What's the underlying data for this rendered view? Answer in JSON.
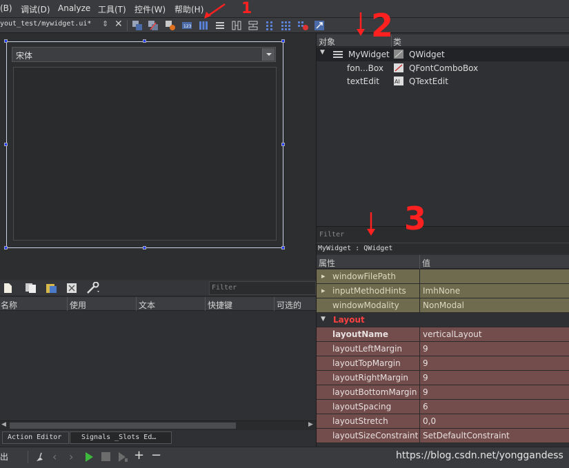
{
  "menu": [
    "(B)",
    "调试(D)",
    "Analyze",
    "工具(T)",
    "控件(W)",
    "帮助(H)"
  ],
  "file": {
    "name": "yout_test/mywidget.ui*"
  },
  "canvas": {
    "combo_text": "宋体"
  },
  "objects": {
    "header": [
      "对象",
      "类"
    ],
    "rows": [
      {
        "name": "MyWidget",
        "cls": "QWidget"
      },
      {
        "name": "fon...Box",
        "cls": "QFontComboBox"
      },
      {
        "name": "textEdit",
        "cls": "QTextEdit"
      }
    ]
  },
  "filter": {
    "placeholder": "Filter",
    "context": "MyWidget : QWidget"
  },
  "props": {
    "header": [
      "属性",
      "值"
    ],
    "section": "Layout",
    "rows": [
      {
        "name": "windowFilePath",
        "value": "",
        "kind": "olive",
        "expand": true
      },
      {
        "name": "inputMethodHints",
        "value": "ImhNone",
        "kind": "olive",
        "expand": true
      },
      {
        "name": "windowModality",
        "value": "NonModal",
        "kind": "olive",
        "expand": false
      },
      {
        "name": "layoutName",
        "value": "verticalLayout",
        "kind": "red",
        "bold": true
      },
      {
        "name": "layoutLeftMargin",
        "value": "9",
        "kind": "red"
      },
      {
        "name": "layoutTopMargin",
        "value": "9",
        "kind": "red"
      },
      {
        "name": "layoutRightMargin",
        "value": "9",
        "kind": "red"
      },
      {
        "name": "layoutBottomMargin",
        "value": "9",
        "kind": "red"
      },
      {
        "name": "layoutSpacing",
        "value": "6",
        "kind": "red"
      },
      {
        "name": "layoutStretch",
        "value": "0,0",
        "kind": "red"
      },
      {
        "name": "layoutSizeConstraint",
        "value": "SetDefaultConstraint",
        "kind": "red"
      }
    ]
  },
  "action": {
    "filter": "Filter",
    "columns": [
      "名称",
      "使用",
      "文本",
      "快捷键",
      "可选的"
    ],
    "tabs": [
      "Action Editor",
      "Signals _Slots Ed…"
    ]
  },
  "bottom": {
    "left": "出",
    "watermark": "https://blog.csdn.net/yonggandess"
  },
  "annotations": [
    "1",
    "2",
    "3"
  ]
}
